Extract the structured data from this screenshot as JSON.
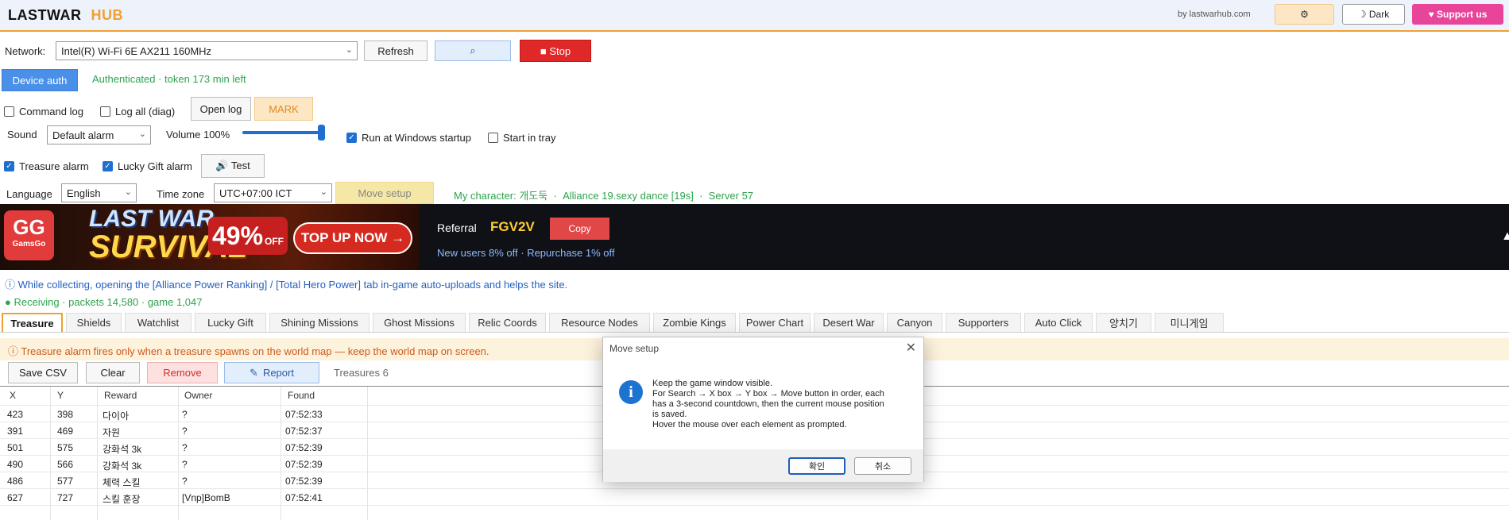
{
  "header": {
    "brand_part1": "LASTWAR",
    "brand_part2": "HUB",
    "by": "by lastwarhub.com",
    "gear_label": "⚙",
    "dark_label": "☽ Dark",
    "support_label": "♥ Support us"
  },
  "network": {
    "label": "Network:",
    "adapter": "Intel(R) Wi-Fi 6E AX211 160MHz",
    "refresh_label": "Refresh",
    "search_label": "⌕",
    "stop_label": "■ Stop"
  },
  "auth": {
    "button_label": "Device auth",
    "status": "Authenticated · token 173 min left"
  },
  "logging": {
    "command_log_label": "Command log",
    "command_log_checked": false,
    "log_all_label": "Log all (diag)",
    "log_all_checked": false,
    "open_log_label": "Open log",
    "mark_label": "MARK"
  },
  "sound": {
    "label": "Sound",
    "value": "Default alarm",
    "volume_label": "Volume 100%",
    "volume_fraction": 1.0,
    "startup_label": "Run at Windows startup",
    "startup_checked": true,
    "tray_label": "Start in tray",
    "tray_checked": false
  },
  "alarms": {
    "treasure_label": "Treasure alarm",
    "treasure_checked": true,
    "lucky_label": "Lucky Gift alarm",
    "lucky_checked": true,
    "test_label": "🔊 Test"
  },
  "locale": {
    "language_label": "Language",
    "language_value": "English",
    "timezone_label": "Time zone",
    "timezone_value": "UTC+07:00 ICT",
    "move_setup_label": "Move setup",
    "character_label": "My character:",
    "character_name": "개도둑",
    "alliance": "Alliance 19.sexy dance [19s]",
    "server": "Server 57"
  },
  "ad": {
    "logo_line1": "GG",
    "logo_line2": "GamsGo",
    "title_line1": "LAST WAR",
    "title_line2": "SURVIVAL",
    "discount": "49%",
    "discount_suffix": "OFF",
    "cta": "TOP UP NOW →"
  },
  "referral": {
    "label": "Referral",
    "code": "FGV2V",
    "copy_label": "Copy",
    "sub": "New users 8% off · Repurchase 1% off"
  },
  "notice": "ⓘ While collecting, opening the [Alliance Power Ranking] / [Total Hero Power] tab in-game auto-uploads and helps the site.",
  "receiving": "● Receiving · packets 14,580 · game 1,047",
  "tabs": [
    "Treasure",
    "Shields",
    "Watchlist",
    "Lucky Gift",
    "Shining Missions",
    "Ghost Missions",
    "Relic Coords",
    "Resource Nodes",
    "Zombie Kings",
    "Power Chart",
    "Desert War",
    "Canyon",
    "Supporters",
    "Auto Click",
    "양치기",
    "미니게임"
  ],
  "active_tab": "Treasure",
  "warning": "ⓘ Treasure alarm fires only when a treasure spawns on the world map — keep the world map on screen.",
  "treasure_toolbar": {
    "save_label": "Save CSV",
    "clear_label": "Clear",
    "remove_label": "Remove",
    "report_label": "Report",
    "count_label": "Treasures 6"
  },
  "table": {
    "columns": [
      "X",
      "Y",
      "Reward",
      "Owner",
      "Found"
    ],
    "rows": [
      [
        "423",
        "398",
        "다이아",
        "?",
        "07:52:33"
      ],
      [
        "391",
        "469",
        "자원",
        "?",
        "07:52:37"
      ],
      [
        "501",
        "575",
        "강화석 3k",
        "?",
        "07:52:39"
      ],
      [
        "490",
        "566",
        "강화석 3k",
        "?",
        "07:52:39"
      ],
      [
        "486",
        "577",
        "체력 스킬",
        "?",
        "07:52:39"
      ],
      [
        "627",
        "727",
        "스킬 훈장",
        "[Vnp]BomB",
        "07:52:41"
      ]
    ]
  },
  "dialog": {
    "title": "Move setup",
    "close": "✕",
    "info_icon": "i",
    "line1": "Keep the game window visible.",
    "line2": "For Search → X box → Y box → Move button in order, each has a 3-second countdown, then the current mouse position is saved.",
    "line3": "Hover the mouse over each element as prompted.",
    "ok_label": "확인",
    "cancel_label": "취소"
  },
  "colors": {
    "accent": "#f0a030",
    "stop_red": "#e02828",
    "auth_blue": "#4a90e8",
    "status_green": "#2da44e",
    "support_pink": "#e8459a",
    "banner_bg": "#0f1116",
    "copy_red": "#e04848",
    "notice_blue": "#2560c0"
  }
}
